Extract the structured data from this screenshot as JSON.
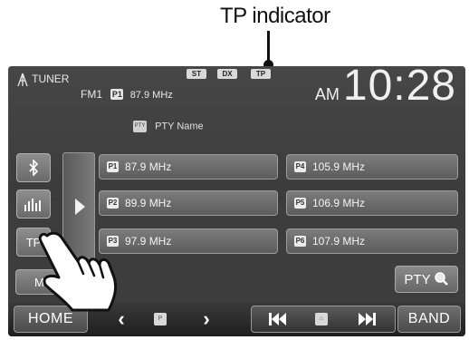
{
  "callout": {
    "label": "TP indicator"
  },
  "header": {
    "source_label": "TUNER",
    "band": "FM1",
    "preset_badge": "P1",
    "frequency": "87.9 MHz",
    "indicators": [
      "ST",
      "DX",
      "TP"
    ],
    "ampm": "AM",
    "time": "10:28",
    "pty_icon_text": "PTY",
    "pty_name": "PTY Name"
  },
  "side_buttons": {
    "tp_label": "TP",
    "mode_label": "Mo"
  },
  "presets": [
    {
      "badge": "P1",
      "freq": "87.9 MHz"
    },
    {
      "badge": "P2",
      "freq": "89.9 MHz"
    },
    {
      "badge": "P3",
      "freq": "97.9 MHz"
    },
    {
      "badge": "P4",
      "freq": "105.9 MHz"
    },
    {
      "badge": "P5",
      "freq": "106.9 MHz"
    },
    {
      "badge": "P6",
      "freq": "107.9 MHz"
    }
  ],
  "pty_search_label": "PTY",
  "bottom_bar": {
    "home_label": "HOME",
    "band_label": "BAND"
  },
  "icons": {
    "antenna": "antenna-icon",
    "bluetooth": "bluetooth-icon",
    "equalizer": "equalizer-icon",
    "search": "magnifier-icon",
    "prev_track": "skip-back-icon",
    "next_track": "skip-forward-icon"
  }
}
